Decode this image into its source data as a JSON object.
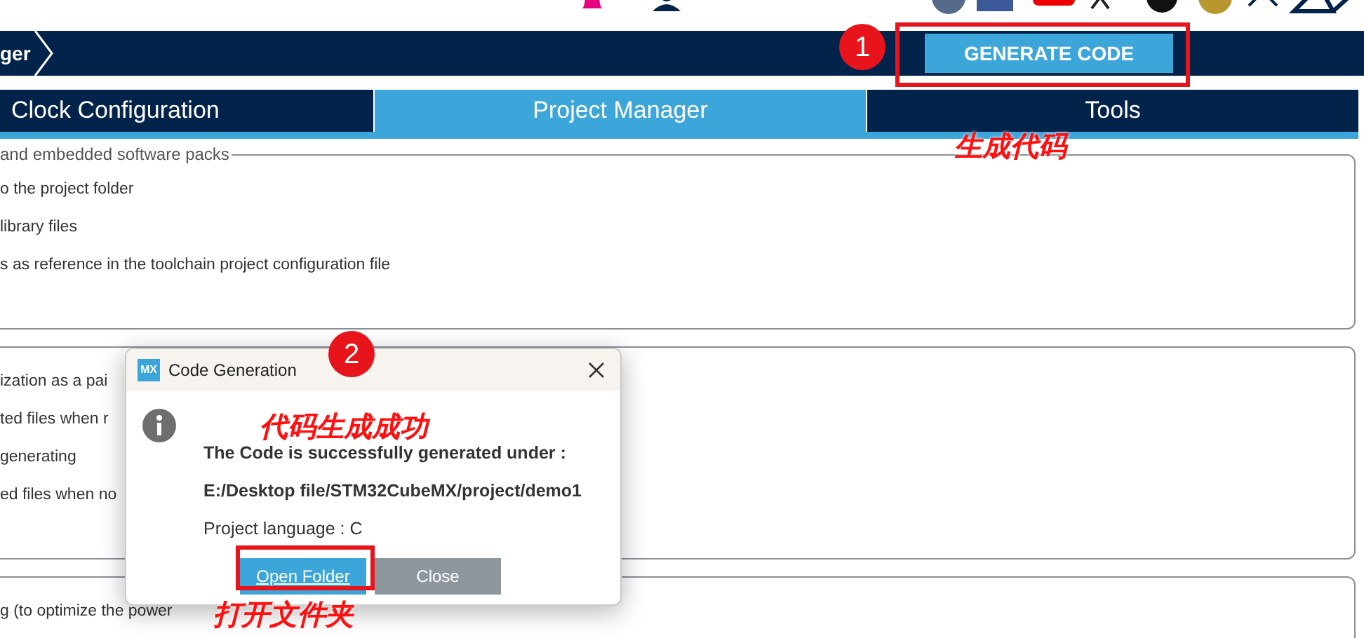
{
  "breadcrumb": {
    "text": "ger"
  },
  "generate_button": {
    "label": "GENERATE CODE"
  },
  "tabs": [
    {
      "label": "Clock Configuration",
      "selected": false
    },
    {
      "label": "Project Manager",
      "selected": true
    },
    {
      "label": "Tools",
      "selected": false
    }
  ],
  "sections": [
    {
      "legend": "and embedded software packs",
      "lines": [
        "o the project folder",
        "library files",
        "s as reference in the toolchain project configuration file"
      ]
    },
    {
      "lines": [
        "ization as a pai",
        "ted files when r",
        "generating",
        "ed files when no"
      ]
    },
    {
      "lines": [
        "g (to optimize the power"
      ]
    }
  ],
  "dialog": {
    "title": "Code Generation",
    "app_badge": "MX",
    "heading": "The Code is successfully generated under :",
    "path": "E:/Desktop file/STM32CubeMX/project/demo1",
    "language": "Project language : C",
    "buttons": [
      {
        "label": "Open Folder",
        "kind": "primary"
      },
      {
        "label": "Close",
        "kind": "secondary"
      }
    ]
  },
  "annotations": [
    {
      "number": "1",
      "callout": "生成代码"
    },
    {
      "number": "2",
      "callout": "代码生成成功"
    },
    {
      "callout": "打开文件夹"
    }
  ]
}
